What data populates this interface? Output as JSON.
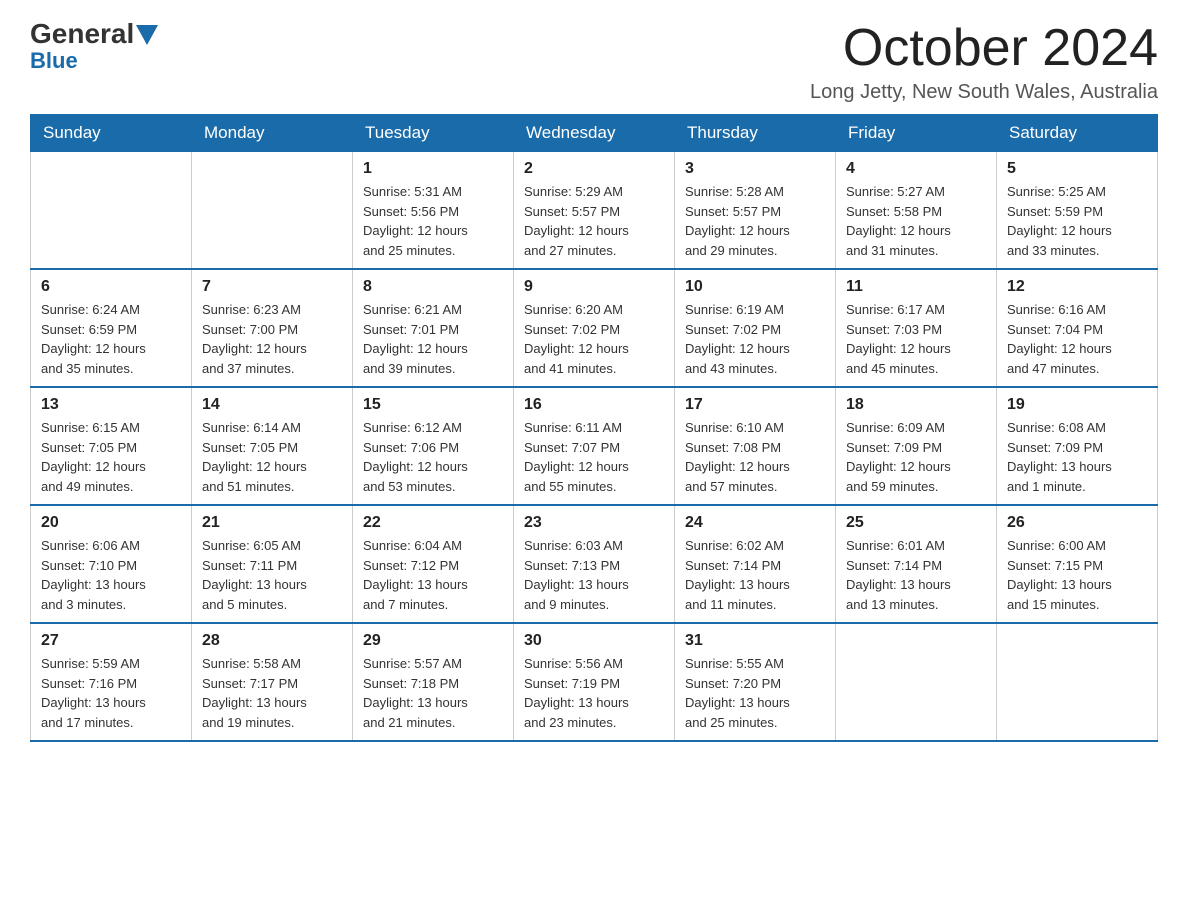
{
  "logo": {
    "general": "General",
    "blue": "Blue"
  },
  "title": "October 2024",
  "subtitle": "Long Jetty, New South Wales, Australia",
  "weekdays": [
    "Sunday",
    "Monday",
    "Tuesday",
    "Wednesday",
    "Thursday",
    "Friday",
    "Saturday"
  ],
  "weeks": [
    [
      {
        "day": "",
        "info": ""
      },
      {
        "day": "",
        "info": ""
      },
      {
        "day": "1",
        "info": "Sunrise: 5:31 AM\nSunset: 5:56 PM\nDaylight: 12 hours\nand 25 minutes."
      },
      {
        "day": "2",
        "info": "Sunrise: 5:29 AM\nSunset: 5:57 PM\nDaylight: 12 hours\nand 27 minutes."
      },
      {
        "day": "3",
        "info": "Sunrise: 5:28 AM\nSunset: 5:57 PM\nDaylight: 12 hours\nand 29 minutes."
      },
      {
        "day": "4",
        "info": "Sunrise: 5:27 AM\nSunset: 5:58 PM\nDaylight: 12 hours\nand 31 minutes."
      },
      {
        "day": "5",
        "info": "Sunrise: 5:25 AM\nSunset: 5:59 PM\nDaylight: 12 hours\nand 33 minutes."
      }
    ],
    [
      {
        "day": "6",
        "info": "Sunrise: 6:24 AM\nSunset: 6:59 PM\nDaylight: 12 hours\nand 35 minutes."
      },
      {
        "day": "7",
        "info": "Sunrise: 6:23 AM\nSunset: 7:00 PM\nDaylight: 12 hours\nand 37 minutes."
      },
      {
        "day": "8",
        "info": "Sunrise: 6:21 AM\nSunset: 7:01 PM\nDaylight: 12 hours\nand 39 minutes."
      },
      {
        "day": "9",
        "info": "Sunrise: 6:20 AM\nSunset: 7:02 PM\nDaylight: 12 hours\nand 41 minutes."
      },
      {
        "day": "10",
        "info": "Sunrise: 6:19 AM\nSunset: 7:02 PM\nDaylight: 12 hours\nand 43 minutes."
      },
      {
        "day": "11",
        "info": "Sunrise: 6:17 AM\nSunset: 7:03 PM\nDaylight: 12 hours\nand 45 minutes."
      },
      {
        "day": "12",
        "info": "Sunrise: 6:16 AM\nSunset: 7:04 PM\nDaylight: 12 hours\nand 47 minutes."
      }
    ],
    [
      {
        "day": "13",
        "info": "Sunrise: 6:15 AM\nSunset: 7:05 PM\nDaylight: 12 hours\nand 49 minutes."
      },
      {
        "day": "14",
        "info": "Sunrise: 6:14 AM\nSunset: 7:05 PM\nDaylight: 12 hours\nand 51 minutes."
      },
      {
        "day": "15",
        "info": "Sunrise: 6:12 AM\nSunset: 7:06 PM\nDaylight: 12 hours\nand 53 minutes."
      },
      {
        "day": "16",
        "info": "Sunrise: 6:11 AM\nSunset: 7:07 PM\nDaylight: 12 hours\nand 55 minutes."
      },
      {
        "day": "17",
        "info": "Sunrise: 6:10 AM\nSunset: 7:08 PM\nDaylight: 12 hours\nand 57 minutes."
      },
      {
        "day": "18",
        "info": "Sunrise: 6:09 AM\nSunset: 7:09 PM\nDaylight: 12 hours\nand 59 minutes."
      },
      {
        "day": "19",
        "info": "Sunrise: 6:08 AM\nSunset: 7:09 PM\nDaylight: 13 hours\nand 1 minute."
      }
    ],
    [
      {
        "day": "20",
        "info": "Sunrise: 6:06 AM\nSunset: 7:10 PM\nDaylight: 13 hours\nand 3 minutes."
      },
      {
        "day": "21",
        "info": "Sunrise: 6:05 AM\nSunset: 7:11 PM\nDaylight: 13 hours\nand 5 minutes."
      },
      {
        "day": "22",
        "info": "Sunrise: 6:04 AM\nSunset: 7:12 PM\nDaylight: 13 hours\nand 7 minutes."
      },
      {
        "day": "23",
        "info": "Sunrise: 6:03 AM\nSunset: 7:13 PM\nDaylight: 13 hours\nand 9 minutes."
      },
      {
        "day": "24",
        "info": "Sunrise: 6:02 AM\nSunset: 7:14 PM\nDaylight: 13 hours\nand 11 minutes."
      },
      {
        "day": "25",
        "info": "Sunrise: 6:01 AM\nSunset: 7:14 PM\nDaylight: 13 hours\nand 13 minutes."
      },
      {
        "day": "26",
        "info": "Sunrise: 6:00 AM\nSunset: 7:15 PM\nDaylight: 13 hours\nand 15 minutes."
      }
    ],
    [
      {
        "day": "27",
        "info": "Sunrise: 5:59 AM\nSunset: 7:16 PM\nDaylight: 13 hours\nand 17 minutes."
      },
      {
        "day": "28",
        "info": "Sunrise: 5:58 AM\nSunset: 7:17 PM\nDaylight: 13 hours\nand 19 minutes."
      },
      {
        "day": "29",
        "info": "Sunrise: 5:57 AM\nSunset: 7:18 PM\nDaylight: 13 hours\nand 21 minutes."
      },
      {
        "day": "30",
        "info": "Sunrise: 5:56 AM\nSunset: 7:19 PM\nDaylight: 13 hours\nand 23 minutes."
      },
      {
        "day": "31",
        "info": "Sunrise: 5:55 AM\nSunset: 7:20 PM\nDaylight: 13 hours\nand 25 minutes."
      },
      {
        "day": "",
        "info": ""
      },
      {
        "day": "",
        "info": ""
      }
    ]
  ]
}
